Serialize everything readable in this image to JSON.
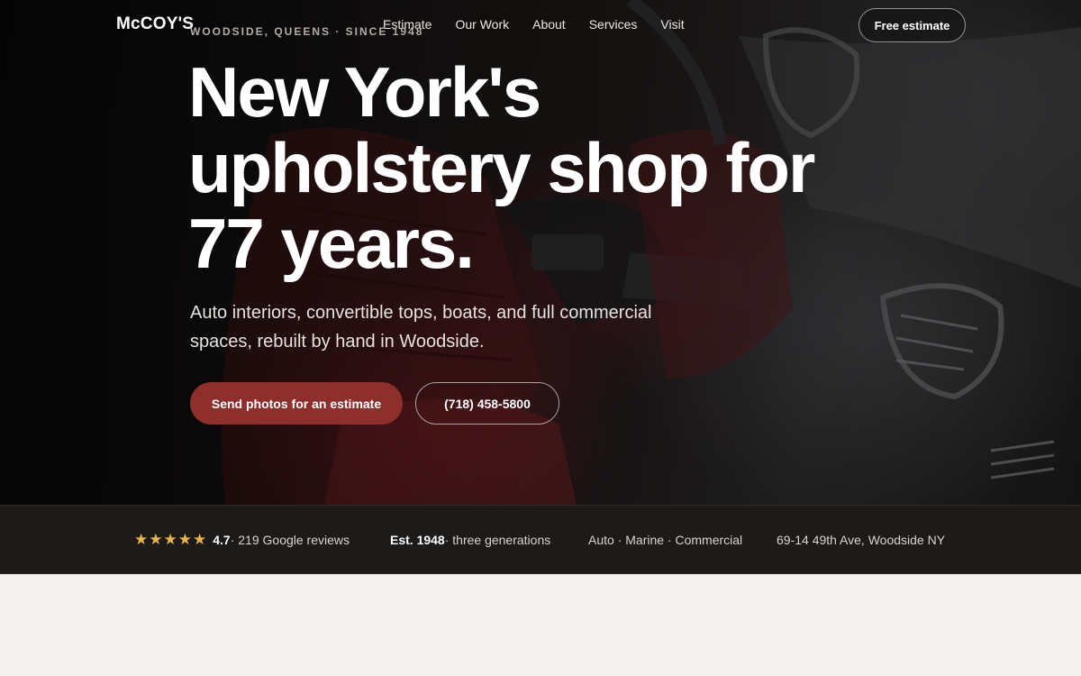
{
  "brand": {
    "name": "McCOY'S",
    "eyebrow": "WOODSIDE, QUEENS · SINCE 1948"
  },
  "nav": {
    "links": [
      "Estimate",
      "Our Work",
      "About",
      "Services",
      "Visit"
    ],
    "cta": "Free estimate"
  },
  "hero": {
    "headline": "New York's upholstery shop for 77 years.",
    "subhead": "Auto interiors, convertible tops, boats, and full commercial spaces, rebuilt by hand in Woodside.",
    "primary_button": "Send photos for an estimate",
    "phone_button": "(718) 458-5800"
  },
  "stats": {
    "rating": {
      "stars": 5,
      "value": "4.7",
      "text": " · 219 Google reviews"
    },
    "established": {
      "value": "Est. 1948",
      "text": " · three generations"
    },
    "services": "Auto · Marine · Commercial",
    "address": "69-14 49th Ave, Woodside NY"
  },
  "colors": {
    "accent": "#8e2f2c",
    "star": "#e9b44c",
    "stats_bar": "#1d1b19",
    "page_bg": "#f4f2ee"
  }
}
